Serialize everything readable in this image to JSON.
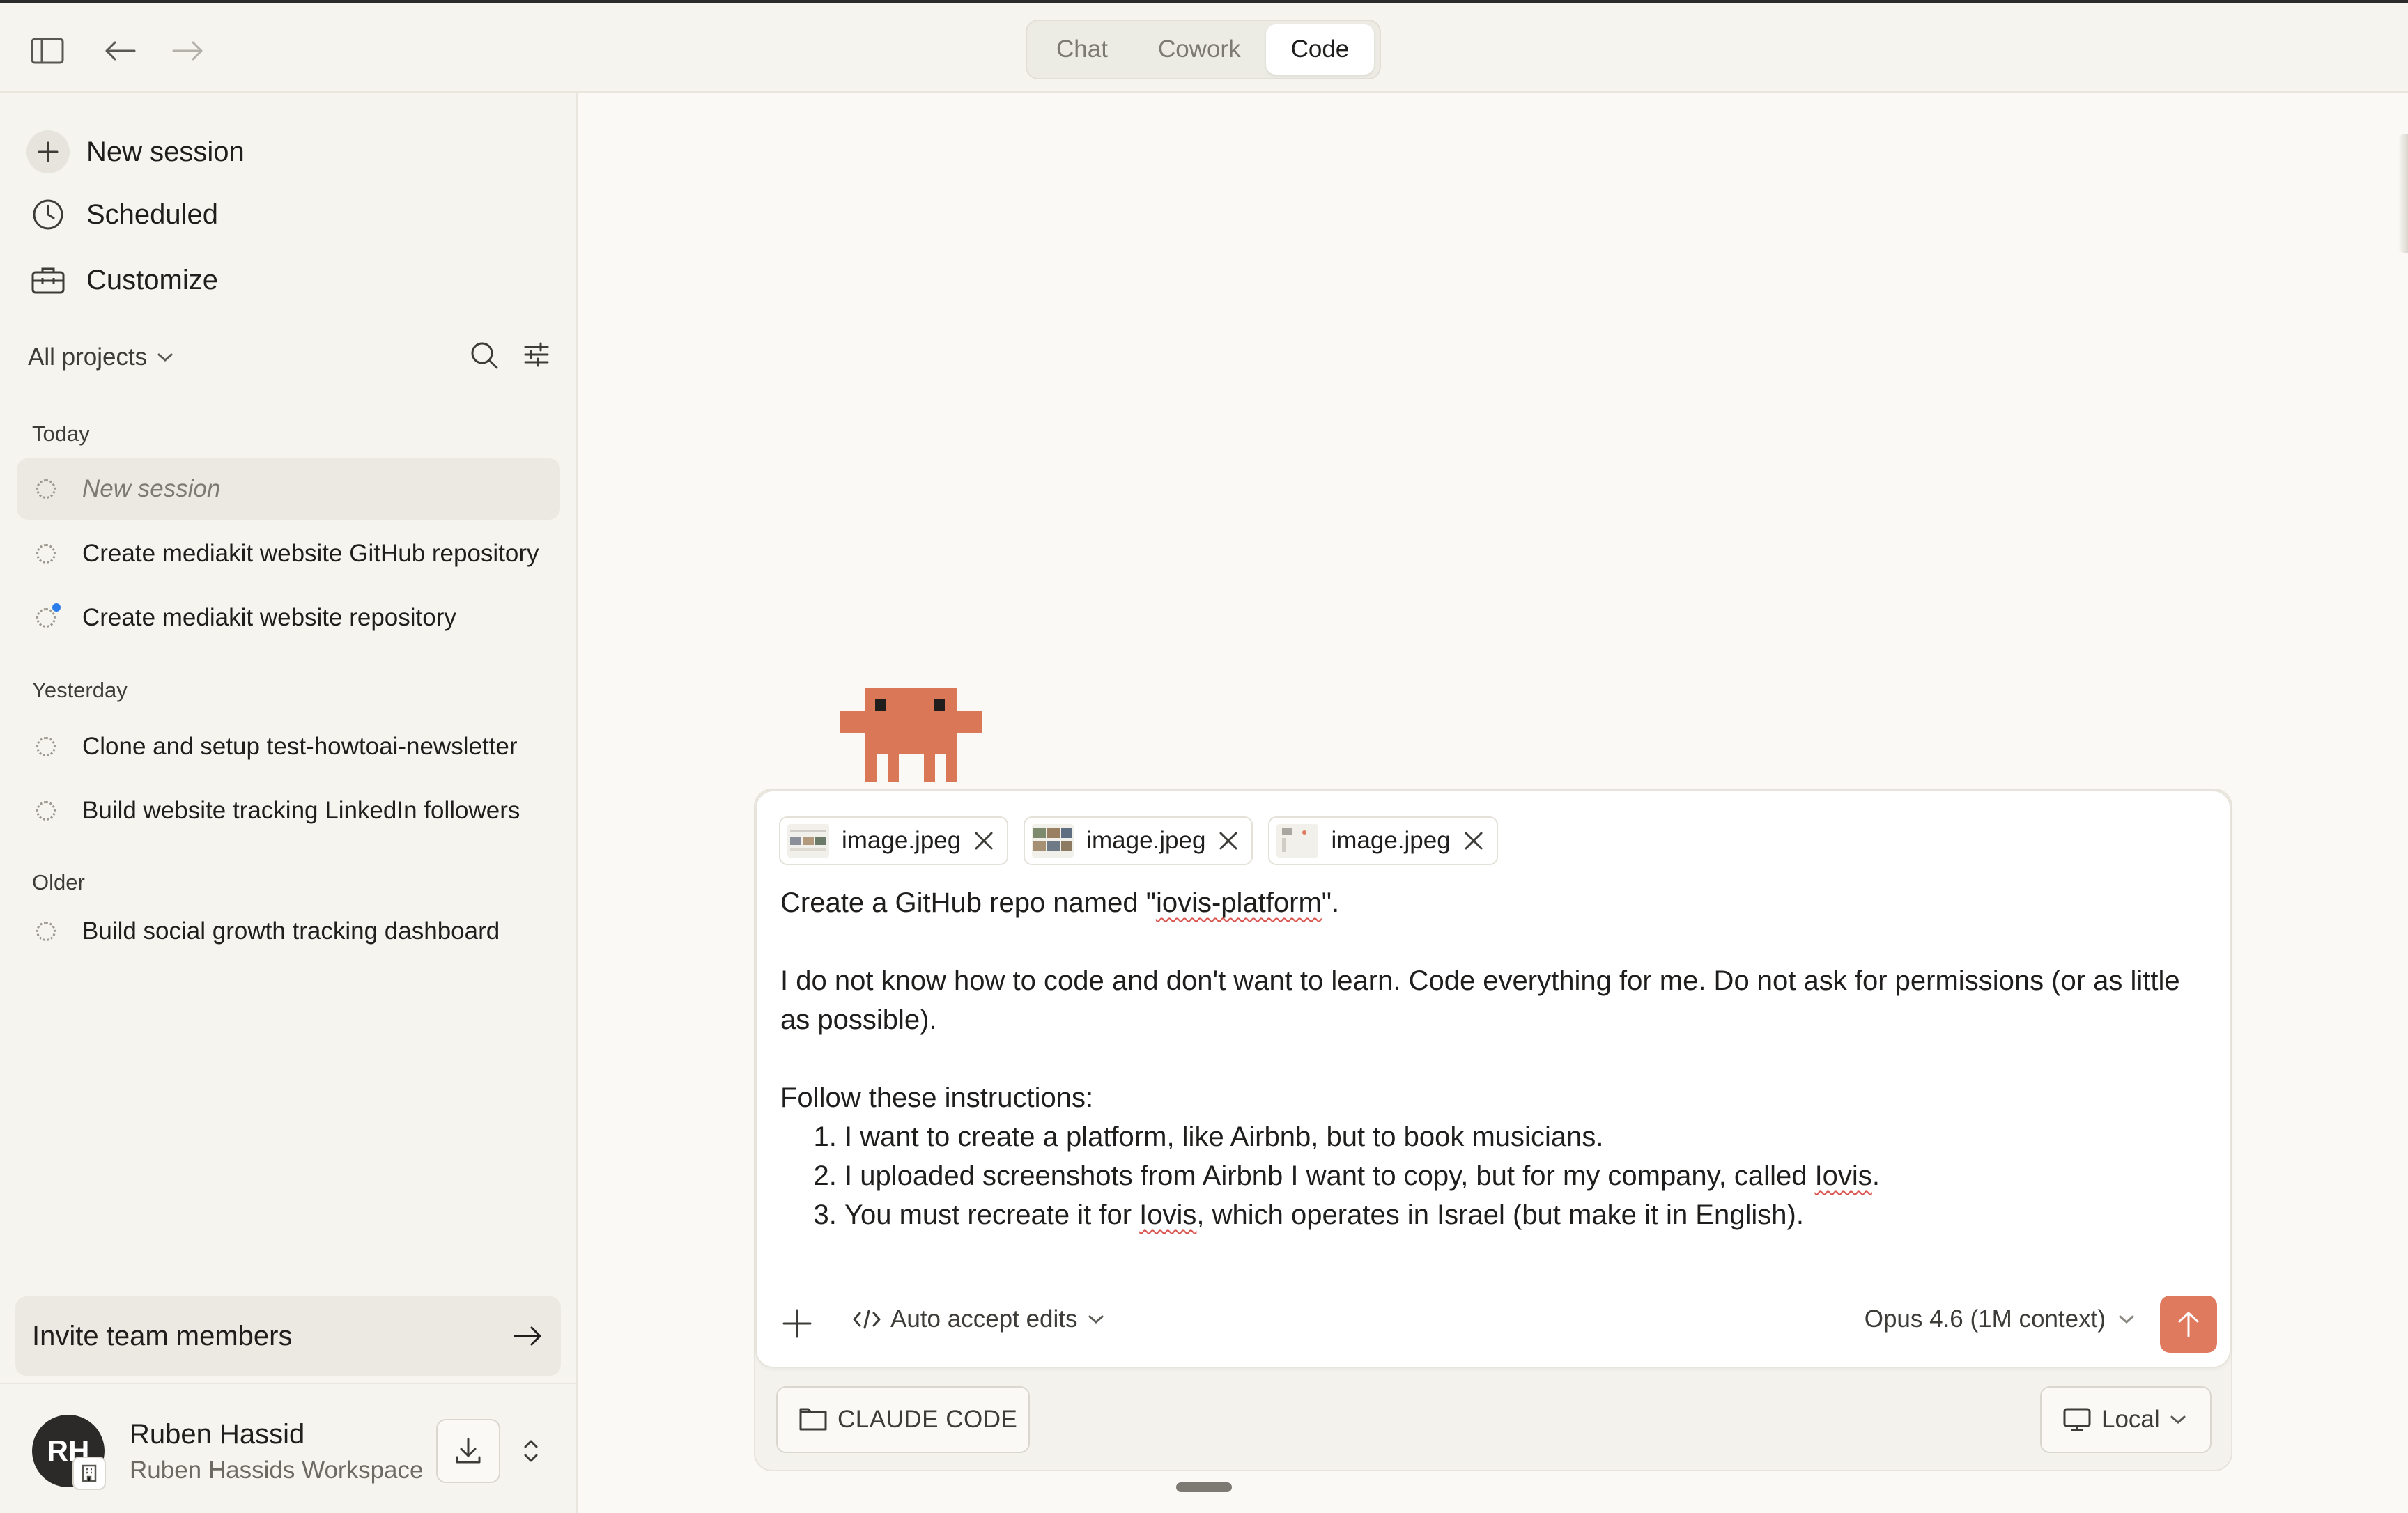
{
  "topbar": {
    "tabs": [
      {
        "label": "Chat",
        "active": false
      },
      {
        "label": "Cowork",
        "active": false
      },
      {
        "label": "Code",
        "active": true
      }
    ]
  },
  "sidebar": {
    "nav": {
      "new_session": "New session",
      "scheduled": "Scheduled",
      "customize": "Customize"
    },
    "projects_filter": "All projects",
    "sections": {
      "today": "Today",
      "yesterday": "Yesterday",
      "older": "Older"
    },
    "sessions": {
      "today": [
        {
          "title": "New session",
          "active": true
        },
        {
          "title": "Create mediakit website GitHub repository",
          "active": false
        },
        {
          "title": "Create mediakit website repository",
          "active": false,
          "unread": true
        }
      ],
      "yesterday": [
        {
          "title": "Clone and setup test-howtoai-newsletter",
          "active": false
        },
        {
          "title": "Build website tracking LinkedIn followers",
          "active": false
        }
      ],
      "older": [
        {
          "title": "Build social growth tracking dashboard",
          "active": false
        }
      ]
    },
    "invite": "Invite team members",
    "user": {
      "initials": "RH",
      "name": "Ruben Hassid",
      "workspace": "Ruben Hassids Workspace"
    }
  },
  "composer": {
    "attachments": [
      {
        "name": "image.jpeg"
      },
      {
        "name": "image.jpeg"
      },
      {
        "name": "image.jpeg"
      }
    ],
    "prompt": {
      "line1_pre": "Create a GitHub repo named \"",
      "line1_repo": "iovis-platform",
      "line1_post": "\".",
      "para2": "I do not know how to code and don't want to learn. Code everything for me. Do not ask for permissions (or as little as possible).",
      "para3_heading": "Follow these instructions:",
      "item1": "I want to create a platform, like Airbnb, but to book musicians.",
      "item2_pre": "I uploaded screenshots from Airbnb I want to copy, but for my company, called ",
      "item2_brand": "Iovis",
      "item2_post": ".",
      "item3_pre": "You must recreate it for ",
      "item3_brand": "Iovis",
      "item3_post": ", which operates in Israel (but make it in English)."
    },
    "mode": "Auto accept edits",
    "model": "Opus 4.6 (1M context)"
  },
  "footer_bar": {
    "folder_label": "CLAUDE CODE",
    "env_label": "Local"
  },
  "colors": {
    "accent": "#e07a5f",
    "unread_dot": "#2b7de9"
  }
}
